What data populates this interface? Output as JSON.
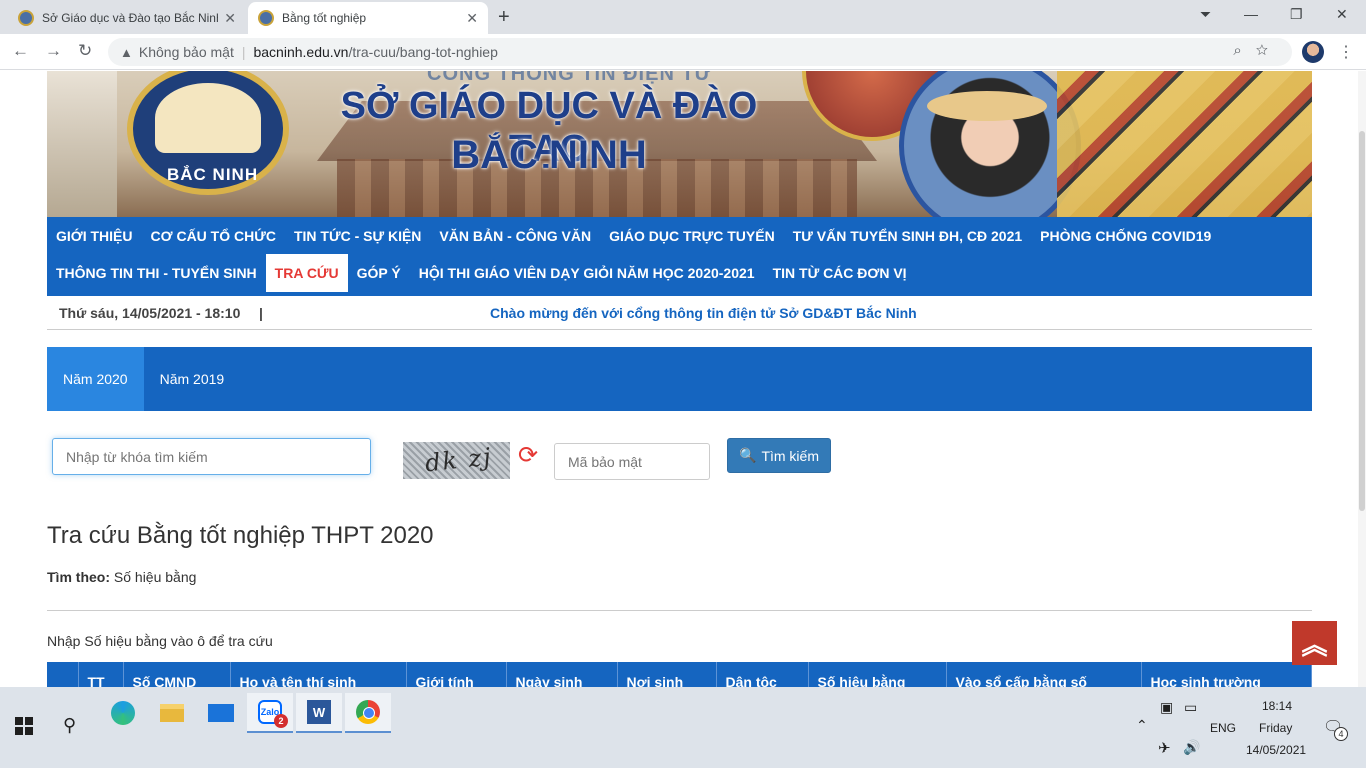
{
  "browser": {
    "tabs": [
      {
        "title": "Sở Giáo dục và Đào tạo Bắc Ninh"
      },
      {
        "title": "Bằng tốt nghiệp"
      }
    ],
    "security_label": "Không bảo mật",
    "url_host": "bacninh.edu.vn",
    "url_path": "/tra-cuu/bang-tot-nghiep"
  },
  "banner": {
    "topline": "CỔNG THÔNG TIN ĐIỆN TỬ",
    "title_line1": "SỞ GIÁO DỤC VÀ ĐÀO TẠO",
    "title_line2": "BẮC NINH",
    "logo_text": "BẮC NINH"
  },
  "mainnav": {
    "row1": [
      "GIỚI THIỆU",
      "CƠ CẤU TỔ CHỨC",
      "TIN TỨC - SỰ KIỆN",
      "VĂN BẢN - CÔNG VĂN",
      "GIÁO DỤC TRỰC TUYẾN",
      "TƯ VẤN TUYỂN SINH ĐH, CĐ 2021",
      "PHÒNG CHỐNG COVID19"
    ],
    "row2": [
      "THÔNG TIN THI - TUYỂN SINH",
      "TRA CỨU",
      "GÓP Ý",
      "HỘI THI GIÁO VIÊN DẠY GIỎI NĂM HỌC 2020-2021",
      "TIN TỪ CÁC ĐƠN VỊ"
    ],
    "active": "TRA CỨU"
  },
  "infobar": {
    "date": "Thứ sáu, 14/05/2021 - 18:10",
    "separator": "|",
    "welcome": "Chào mừng đến với cổng thông tin điện tử Sở GD&ĐT Bắc Ninh"
  },
  "year_tabs": [
    {
      "label": "Năm 2020",
      "active": true
    },
    {
      "label": "Năm 2019",
      "active": false
    }
  ],
  "search": {
    "keyword_placeholder": "Nhập từ khóa tìm kiếm",
    "captcha_text": "dk zj",
    "code_placeholder": "Mã bảo mật",
    "button_label": "Tìm kiếm"
  },
  "content": {
    "heading": "Tra cứu Bằng tốt nghiệp THPT 2020",
    "find_by_label": "Tìm theo:",
    "find_by_value": "Số hiệu bằng",
    "hint": "Nhập Số hiệu bằng vào ô để tra cứu"
  },
  "table": {
    "headers": [
      "",
      "TT",
      "Số CMND",
      "Họ và tên thí sinh",
      "Giới tính",
      "Ngày sinh",
      "Nơi sinh",
      "Dân tộc",
      "Số hiệu bằng",
      "Vào sổ cấp bằng số",
      "Học sinh trường"
    ]
  },
  "taskbar": {
    "zalo_badge": "2",
    "lang": "ENG",
    "time": "18:14",
    "day": "Friday",
    "date": "14/05/2021",
    "notif_count": "4"
  },
  "colors": {
    "nav_blue": "#1565c0",
    "active_red": "#e53935",
    "button_blue": "#337ab7",
    "totop_red": "#c0392b"
  }
}
